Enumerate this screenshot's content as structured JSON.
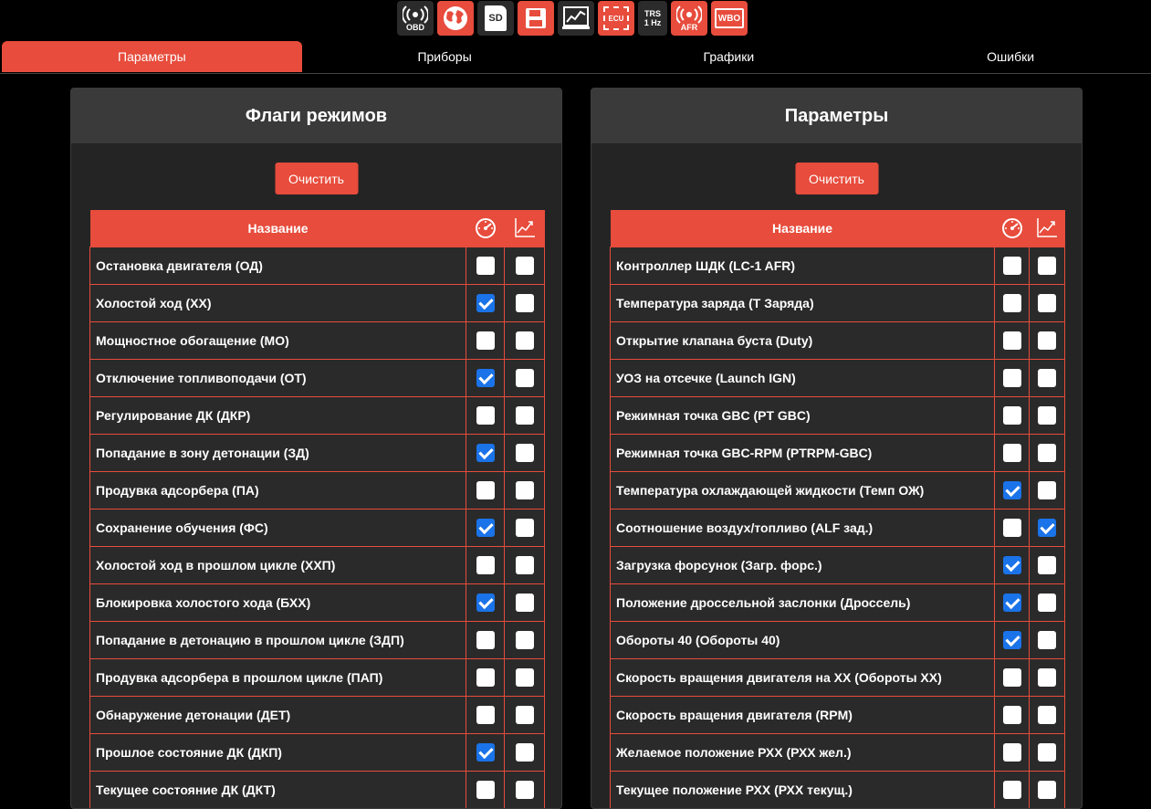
{
  "toolbar": {
    "icons": [
      {
        "name": "obd-icon",
        "label": "OBD"
      },
      {
        "name": "globe-icon",
        "label": ""
      },
      {
        "name": "sd-card-icon",
        "label": "SD"
      },
      {
        "name": "save-icon",
        "label": ""
      },
      {
        "name": "chart-monitor-icon",
        "label": ""
      },
      {
        "name": "ecu-icon",
        "label": "ECU"
      },
      {
        "name": "trs-icon",
        "label": "TRS\n1 Hz"
      },
      {
        "name": "afr-icon",
        "label": "AFR"
      },
      {
        "name": "wbo-icon",
        "label": "WBO"
      }
    ],
    "colors": {
      "accent": "#e74c3c",
      "dark": "#2b2b2b"
    }
  },
  "tabs": [
    {
      "label": "Параметры",
      "active": true
    },
    {
      "label": "Приборы",
      "active": false
    },
    {
      "label": "Графики",
      "active": false
    },
    {
      "label": "Ошибки",
      "active": false
    }
  ],
  "left_panel": {
    "title": "Флаги режимов",
    "clear_label": "Очистить",
    "column_name": "Название",
    "rows": [
      {
        "name": "Остановка двигателя (ОД)",
        "gauge": false,
        "chart": false
      },
      {
        "name": "Холостой ход (ХХ)",
        "gauge": true,
        "chart": false
      },
      {
        "name": "Мощностное обогащение (МО)",
        "gauge": false,
        "chart": false
      },
      {
        "name": "Отключение топливоподачи (ОТ)",
        "gauge": true,
        "chart": false
      },
      {
        "name": "Регулирование ДК (ДКР)",
        "gauge": false,
        "chart": false
      },
      {
        "name": "Попадание в зону детонации (ЗД)",
        "gauge": true,
        "chart": false
      },
      {
        "name": "Продувка адсорбера (ПА)",
        "gauge": false,
        "chart": false
      },
      {
        "name": "Сохранение обучения (ФС)",
        "gauge": true,
        "chart": false
      },
      {
        "name": "Холостой ход в прошлом цикле (ХХП)",
        "gauge": false,
        "chart": false
      },
      {
        "name": "Блокировка холостого хода (БХХ)",
        "gauge": true,
        "chart": false
      },
      {
        "name": "Попадание в детонацию в прошлом цикле (ЗДП)",
        "gauge": false,
        "chart": false
      },
      {
        "name": "Продувка адсорбера в прошлом цикле (ПАП)",
        "gauge": false,
        "chart": false
      },
      {
        "name": "Обнаружение детонации (ДЕТ)",
        "gauge": false,
        "chart": false
      },
      {
        "name": "Прошлое состояние ДК (ДКП)",
        "gauge": true,
        "chart": false
      },
      {
        "name": "Текущее состояние ДК (ДКТ)",
        "gauge": false,
        "chart": false
      }
    ]
  },
  "right_panel": {
    "title": "Параметры",
    "clear_label": "Очистить",
    "column_name": "Название",
    "rows": [
      {
        "name": "Контроллер ШДК (LC-1 AFR)",
        "gauge": false,
        "chart": false
      },
      {
        "name": "Температура заряда (Т Заряда)",
        "gauge": false,
        "chart": false
      },
      {
        "name": "Открытие клапана буста (Duty)",
        "gauge": false,
        "chart": false
      },
      {
        "name": "УОЗ на отсечке (Launch IGN)",
        "gauge": false,
        "chart": false
      },
      {
        "name": "Режимная точка GBC (PT GBC)",
        "gauge": false,
        "chart": false
      },
      {
        "name": "Режимная точка GBC-RPM (PTRPM-GBC)",
        "gauge": false,
        "chart": false
      },
      {
        "name": "Температура охлаждающей жидкости (Темп ОЖ)",
        "gauge": true,
        "chart": false
      },
      {
        "name": "Соотношение воздух/топливо (ALF зад.)",
        "gauge": false,
        "chart": true
      },
      {
        "name": "Загрузка форсунок (Загр. форс.)",
        "gauge": true,
        "chart": false
      },
      {
        "name": "Положение дроссельной заслонки (Дроссель)",
        "gauge": true,
        "chart": false
      },
      {
        "name": "Обороты 40 (Обороты 40)",
        "gauge": true,
        "chart": false
      },
      {
        "name": "Скорость вращения двигателя на ХХ (Обороты ХХ)",
        "gauge": false,
        "chart": false
      },
      {
        "name": "Скорость вращения двигателя (RPM)",
        "gauge": false,
        "chart": false
      },
      {
        "name": "Желаемое положение РХХ (РХХ жел.)",
        "gauge": false,
        "chart": false
      },
      {
        "name": "Текущее положение РХХ (РХХ текущ.)",
        "gauge": false,
        "chart": false
      }
    ]
  }
}
